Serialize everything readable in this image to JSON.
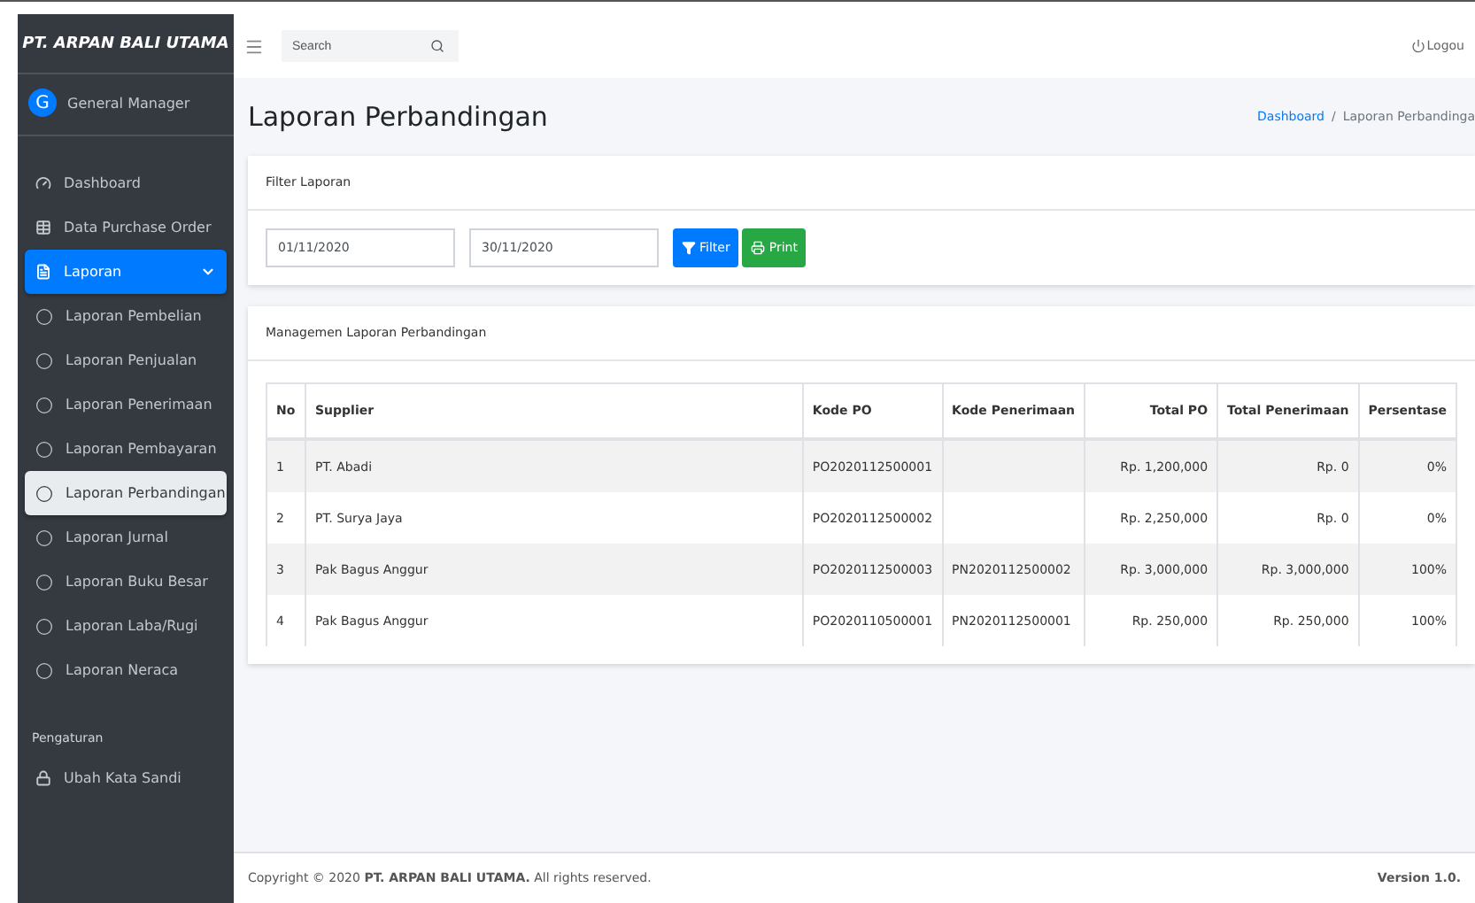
{
  "sidebar": {
    "brand": "PT. ARPAN BALI UTAMA",
    "user": {
      "initial": "G",
      "name": "General Manager"
    },
    "menu": [
      {
        "label": "Dashboard",
        "selected": false
      },
      {
        "label": "Data Purchase Order",
        "selected": false
      },
      {
        "label": "Laporan",
        "selected": true,
        "expanded": true,
        "children": [
          {
            "label": "Laporan Pembelian",
            "selected": false
          },
          {
            "label": "Laporan Penjualan",
            "selected": false
          },
          {
            "label": "Laporan Penerimaan",
            "selected": false
          },
          {
            "label": "Laporan Pembayaran",
            "selected": false
          },
          {
            "label": "Laporan Perbandingan",
            "selected": true
          },
          {
            "label": "Laporan Jurnal",
            "selected": false
          },
          {
            "label": "Laporan Buku Besar",
            "selected": false
          },
          {
            "label": "Laporan Laba/Rugi",
            "selected": false
          },
          {
            "label": "Laporan Neraca",
            "selected": false
          }
        ]
      }
    ],
    "settings_header": "Pengaturan",
    "settings_items": [
      {
        "label": "Ubah Kata Sandi",
        "selected": false
      }
    ]
  },
  "navbar": {
    "search_placeholder": "Search",
    "logout": "Logou"
  },
  "page": {
    "title": "Laporan Perbandingan",
    "breadcrumb": [
      "Dashboard",
      "Laporan Perbandinga"
    ],
    "breadcrumb_separator": "/"
  },
  "filter": {
    "title": "Filter Laporan",
    "date_from": "01/11/2020",
    "date_to": "30/11/2020",
    "buttons": [
      "Filter",
      "Print"
    ]
  },
  "table_card": {
    "title": "Managemen Laporan Perbandingan",
    "columns": [
      "No",
      "Supplier",
      "Kode PO",
      "Kode Penerimaan",
      "Total PO",
      "Total Penerimaan",
      "Persentase"
    ],
    "rows": [
      [
        "1",
        "PT. Abadi",
        "PO2020112500001",
        "",
        "Rp. 1,200,000",
        "Rp. 0",
        "0%"
      ],
      [
        "2",
        "PT. Surya Jaya",
        "PO2020112500002",
        "",
        "Rp. 2,250,000",
        "Rp. 0",
        "0%"
      ],
      [
        "3",
        "Pak Bagus Anggur",
        "PO2020112500003",
        "PN2020112500002",
        "Rp. 3,000,000",
        "Rp. 3,000,000",
        "100%"
      ],
      [
        "4",
        "Pak Bagus Anggur",
        "PO2020110500001",
        "PN2020112500001",
        "Rp. 250,000",
        "Rp. 250,000",
        "100%"
      ]
    ]
  },
  "footer": {
    "copyright": "Copyright © 2020 **PT. ARPAN BALI UTAMA.** All rights reserved.",
    "version": "Version 1.0."
  }
}
